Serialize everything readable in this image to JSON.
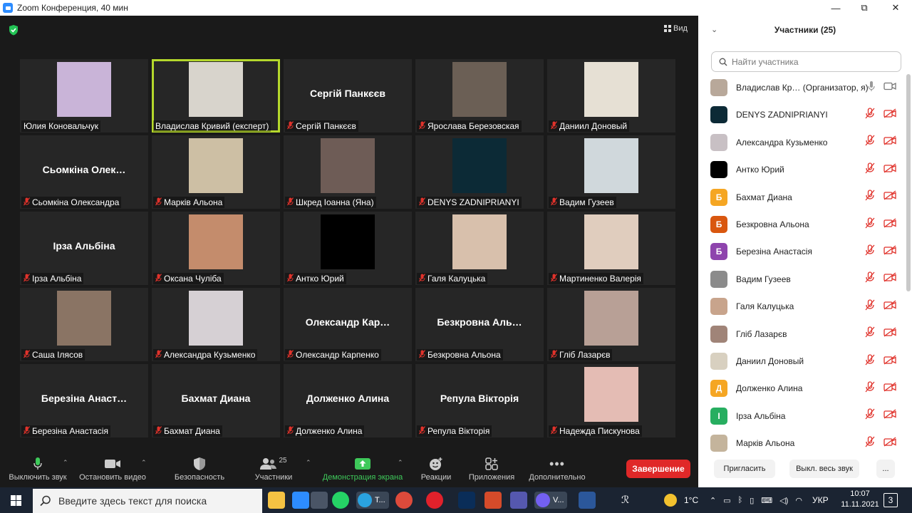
{
  "window": {
    "title": "Zoom Конференция, 40 мин",
    "controls": {
      "minimize": "—",
      "restore": "⧉",
      "close": "✕"
    }
  },
  "meeting": {
    "view_label": "Вид",
    "shield_icon": "shield-check-icon",
    "active_speaker_color": "#b5d82c",
    "tiles": [
      {
        "name": "Юлия Коновальчук",
        "big": "",
        "photo": "#c9b4d8",
        "muted": false
      },
      {
        "name": "Владислав Кривий (експерт)",
        "big": "",
        "photo": "#d8d4cc",
        "muted": false,
        "active": true
      },
      {
        "name": "Сергій Панкєєв",
        "big": "Сергій Панкєєв",
        "photo": "",
        "muted": true
      },
      {
        "name": "Ярослава Березовская",
        "big": "",
        "photo": "#6b5f55",
        "muted": true
      },
      {
        "name": "Даниил Доновый",
        "big": "",
        "photo": "#e6e0d4",
        "muted": true
      },
      {
        "name": "Сьомкіна Олександра",
        "big": "Сьомкіна Олек…",
        "photo": "",
        "muted": true
      },
      {
        "name": "Марків Альона",
        "big": "",
        "photo": "#cdbfa4",
        "muted": true
      },
      {
        "name": "Шкред Іоанна (Яна)",
        "big": "",
        "photo": "#6e5c56",
        "muted": true
      },
      {
        "name": "DENYS ZADNIPRIANYI",
        "big": "",
        "photo": "#0c2a36",
        "muted": true
      },
      {
        "name": "Вадим Гузеев",
        "big": "",
        "photo": "#d0d8dc",
        "muted": true
      },
      {
        "name": "Ірза Альбіна",
        "big": "Ірза Альбіна",
        "photo": "",
        "muted": true
      },
      {
        "name": "Оксана Чуліба",
        "big": "",
        "photo": "#c48c6c",
        "muted": true
      },
      {
        "name": "Антко Юрий",
        "big": "",
        "photo": "#000000",
        "muted": true
      },
      {
        "name": "Галя Калуцька",
        "big": "",
        "photo": "#d8c0ac",
        "muted": true
      },
      {
        "name": "Мартиненко Валерія",
        "big": "",
        "photo": "#e0cdbe",
        "muted": true
      },
      {
        "name": "Саша Ілясов",
        "big": "",
        "photo": "#8a7464",
        "muted": true
      },
      {
        "name": "Александра Кузьменко",
        "big": "",
        "photo": "#d6d0d4",
        "muted": true
      },
      {
        "name": "Олександр Карпенко",
        "big": "Олександр Кар…",
        "photo": "",
        "muted": true
      },
      {
        "name": "Безкровна Альона",
        "big": "Безкровна Аль…",
        "photo": "",
        "muted": true
      },
      {
        "name": "Гліб Лазарєв",
        "big": "",
        "photo": "#b8a096",
        "muted": true
      },
      {
        "name": "Березіна Анастасія",
        "big": "Березіна Анаст…",
        "photo": "",
        "muted": true
      },
      {
        "name": "Бахмат Диана",
        "big": "Бахмат Диана",
        "photo": "",
        "muted": true
      },
      {
        "name": "Долженко Алина",
        "big": "Долженко Алина",
        "photo": "",
        "muted": true
      },
      {
        "name": "Репула Вікторія",
        "big": "Репула Вікторія",
        "photo": "",
        "muted": true
      },
      {
        "name": "Надежда Пискунова",
        "big": "",
        "photo": "#e4bcb4",
        "muted": true
      }
    ]
  },
  "toolbar": {
    "mute": "Выключить звук",
    "video": "Остановить видео",
    "security": "Безопасность",
    "participants": "Участники",
    "participants_count": "25",
    "share": "Демонстрация экрана",
    "reactions": "Реакции",
    "apps": "Приложения",
    "more": "Дополнительно",
    "end": "Завершение",
    "share_color": "#3ec95a",
    "end_color": "#e02828"
  },
  "panel": {
    "title": "Участники (25)",
    "search_placeholder": "Найти участника",
    "invite": "Пригласить",
    "mute_all": "Выкл. весь звук",
    "more": "...",
    "participants": [
      {
        "name": "Владислав Кр… (Организатор, я)",
        "avatar": "#b8a89a",
        "letter": "",
        "host": true
      },
      {
        "name": "DENYS ZADNIPRIANYI",
        "avatar": "#0c2a36",
        "letter": ""
      },
      {
        "name": "Александра Кузьменко",
        "avatar": "#c8c0c4",
        "letter": ""
      },
      {
        "name": "Антко Юрий",
        "avatar": "#000000",
        "letter": ""
      },
      {
        "name": "Бахмат Диана",
        "avatar": "#f5a623",
        "letter": "Б"
      },
      {
        "name": "Безкровна Альона",
        "avatar": "#d9570f",
        "letter": "Б"
      },
      {
        "name": "Березіна Анастасія",
        "avatar": "#8e44ad",
        "letter": "Б"
      },
      {
        "name": "Вадим Гузеев",
        "avatar": "#8b8b8b",
        "letter": ""
      },
      {
        "name": "Галя Калуцька",
        "avatar": "#c8a48c",
        "letter": ""
      },
      {
        "name": "Гліб Лазарєв",
        "avatar": "#a08478",
        "letter": ""
      },
      {
        "name": "Даниил Доновый",
        "avatar": "#d8d0c0",
        "letter": ""
      },
      {
        "name": "Долженко Алина",
        "avatar": "#f5a623",
        "letter": "Д"
      },
      {
        "name": "Ірза Альбіна",
        "avatar": "#27ae60",
        "letter": "І"
      },
      {
        "name": "Марків Альона",
        "avatar": "#c4b49c",
        "letter": ""
      }
    ]
  },
  "taskbar": {
    "search_text": "Введите здесь текст для поиска",
    "temperature": "1°C",
    "language": "УКР",
    "time": "10:07",
    "date": "11.11.2021",
    "notifications": "3",
    "telegram_label": "T...",
    "viber_label": "V..."
  }
}
